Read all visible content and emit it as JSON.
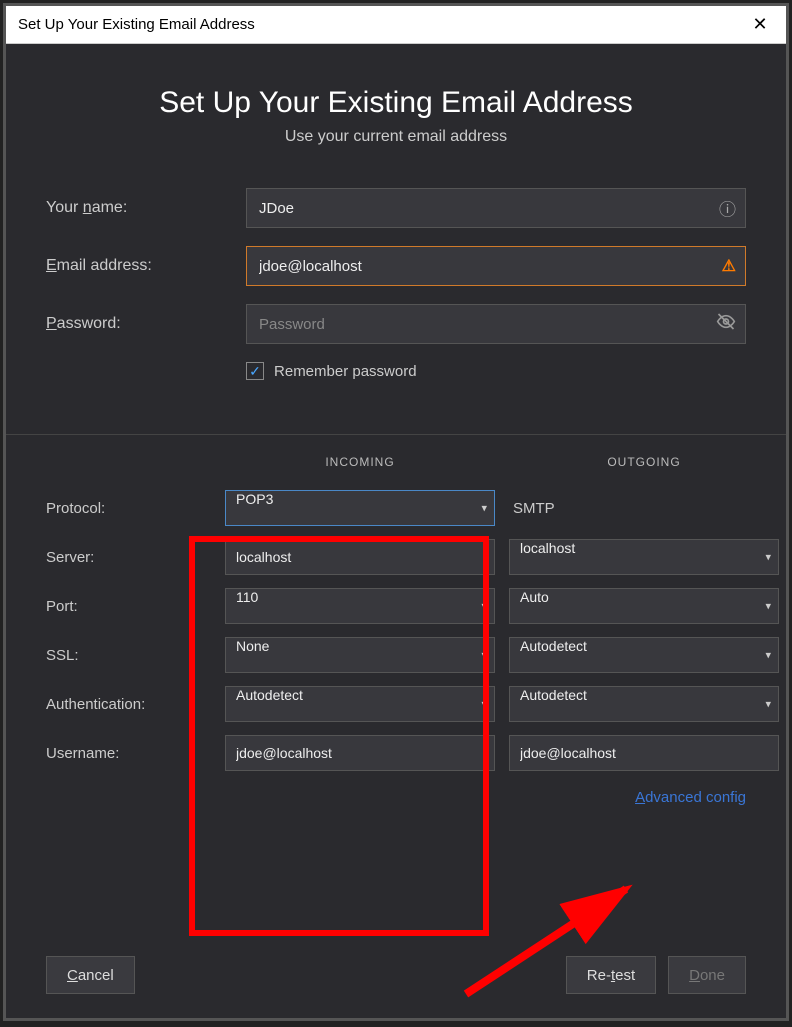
{
  "window": {
    "title": "Set Up Your Existing Email Address"
  },
  "header": {
    "title": "Set Up Your Existing Email Address",
    "subtitle": "Use your current email address"
  },
  "form": {
    "name_label_pre": "Your ",
    "name_label_ul": "n",
    "name_label_post": "ame:",
    "name_value": "JDoe",
    "email_label_ul": "E",
    "email_label_post": "mail address:",
    "email_value": "jdoe@localhost",
    "password_label_ul": "P",
    "password_label_post": "assword:",
    "password_value": "",
    "password_placeholder": "Password",
    "remember_label_pre": "R",
    "remember_label_ul": "e",
    "remember_label_post": "member password",
    "remember_checked": true
  },
  "config": {
    "incoming_head": "INCOMING",
    "outgoing_head": "OUTGOING",
    "labels": {
      "protocol": "Protocol:",
      "server": "Server:",
      "port": "Port:",
      "ssl": "SSL:",
      "auth": "Authentication:",
      "username": "Username:"
    },
    "incoming": {
      "protocol": "POP3",
      "server": "localhost",
      "port": "110",
      "ssl": "None",
      "auth": "Autodetect",
      "username": "jdoe@localhost"
    },
    "outgoing": {
      "protocol": "SMTP",
      "server": "localhost",
      "port": "Auto",
      "ssl": "Autodetect",
      "auth": "Autodetect",
      "username": "jdoe@localhost"
    }
  },
  "links": {
    "advanced_ul": "A",
    "advanced_rest": "dvanced config"
  },
  "buttons": {
    "cancel_ul": "C",
    "cancel_rest": "ancel",
    "retest_pre": "Re-",
    "retest_ul": "t",
    "retest_post": "est",
    "done_ul": "D",
    "done_rest": "one"
  }
}
